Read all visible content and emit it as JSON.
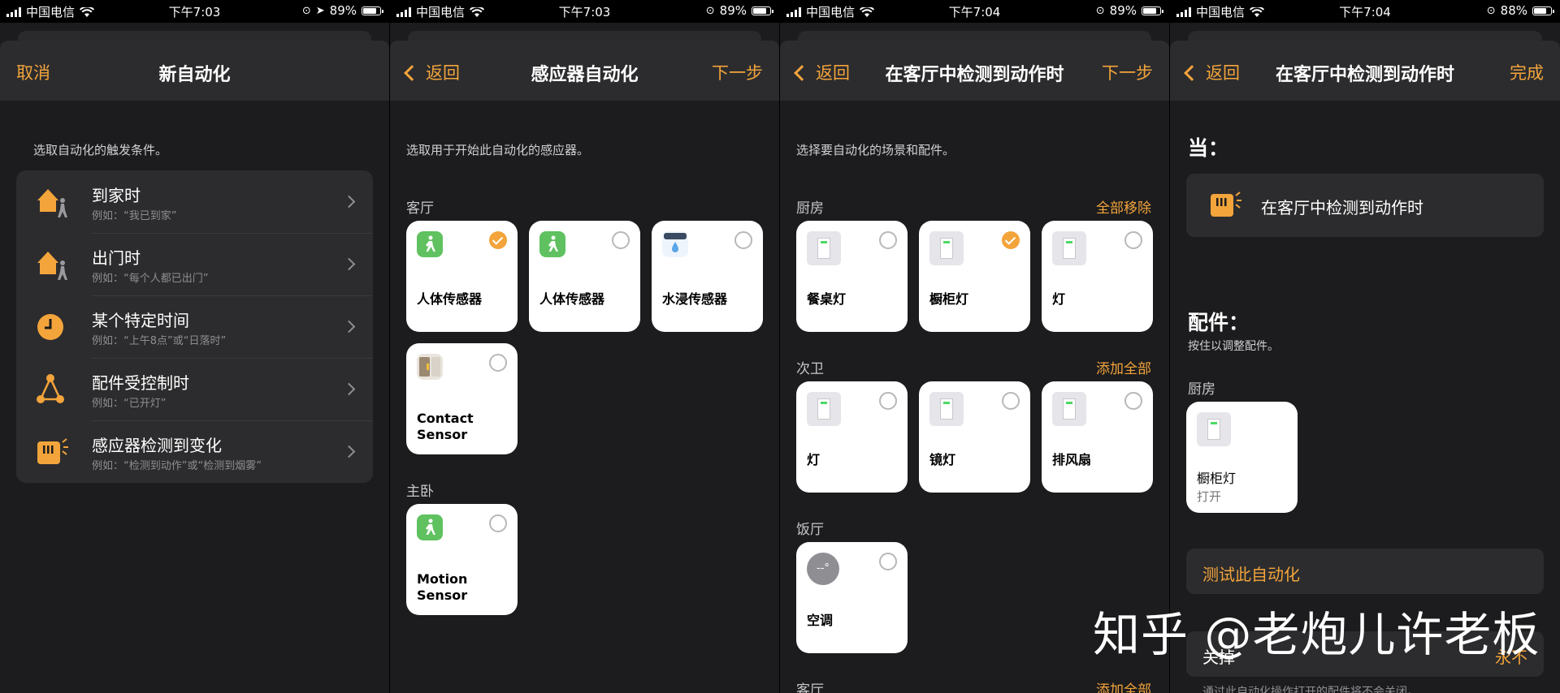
{
  "panels": [
    {
      "status": {
        "carrier": "中国电信",
        "time": "下午7:03",
        "battery": "89%"
      },
      "nav": {
        "left": "取消",
        "title": "新自动化",
        "right": ""
      },
      "instruction": "选取自动化的触发条件。",
      "items": [
        {
          "title": "到家时",
          "subtitle": "例如：“我已到家”",
          "icon": "home-person-icon"
        },
        {
          "title": "出门时",
          "subtitle": "例如：“每个人都已出门”",
          "icon": "home-person-leave-icon"
        },
        {
          "title": "某个特定时间",
          "subtitle": "例如：“上午8点”或“日落时”",
          "icon": "clock-icon"
        },
        {
          "title": "配件受控制时",
          "subtitle": "例如：“已开灯”",
          "icon": "accessory-network-icon"
        },
        {
          "title": "感应器检测到变化",
          "subtitle": "例如：“检测到动作”或“检测到烟雾”",
          "icon": "sensor-icon"
        }
      ]
    },
    {
      "status": {
        "carrier": "中国电信",
        "time": "下午7:03",
        "battery": "89%"
      },
      "nav": {
        "left": "返回",
        "title": "感应器自动化",
        "right": "下一步"
      },
      "instruction": "选取用于开始此自动化的感应器。",
      "sections": [
        {
          "label": "客厅",
          "tiles": [
            {
              "name": "人体传感器",
              "icon": "motion-sensor-icon",
              "checked": true
            },
            {
              "name": "人体传感器",
              "icon": "motion-sensor-icon",
              "checked": false
            },
            {
              "name": "水浸传感器",
              "icon": "water-sensor-icon",
              "checked": false
            },
            {
              "name": "Contact Sensor",
              "icon": "contact-sensor-icon",
              "checked": false
            }
          ]
        },
        {
          "label": "主卧",
          "tiles": [
            {
              "name": "Motion Sensor",
              "icon": "motion-sensor-icon",
              "checked": false
            }
          ]
        }
      ]
    },
    {
      "status": {
        "carrier": "中国电信",
        "time": "下午7:04",
        "battery": "89%"
      },
      "nav": {
        "left": "返回",
        "title": "在客厅中检测到动作时",
        "right": "下一步"
      },
      "instruction": "选择要自动化的场景和配件。",
      "sections": [
        {
          "label": "厨房",
          "action": "全部移除",
          "tiles": [
            {
              "name": "餐桌灯",
              "icon": "light-switch-icon",
              "checked": false
            },
            {
              "name": "橱柜灯",
              "icon": "light-switch-icon",
              "checked": true
            },
            {
              "name": "灯",
              "icon": "light-switch-icon",
              "checked": false
            }
          ]
        },
        {
          "label": "次卫",
          "action": "添加全部",
          "tiles": [
            {
              "name": "灯",
              "icon": "light-switch-icon",
              "checked": false
            },
            {
              "name": "镜灯",
              "icon": "light-switch-icon",
              "checked": false
            },
            {
              "name": "排风扇",
              "icon": "light-switch-icon",
              "checked": false
            }
          ]
        },
        {
          "label": "饭厅",
          "tiles": [
            {
              "name": "空调",
              "icon": "thermostat-icon",
              "checked": false,
              "icon_text": "--°"
            }
          ]
        },
        {
          "label": "客厅",
          "action": "添加全部",
          "tiles": []
        }
      ]
    },
    {
      "status": {
        "carrier": "中国电信",
        "time": "下午7:04",
        "battery": "88%"
      },
      "nav": {
        "left": "返回",
        "title": "在客厅中检测到动作时",
        "right": "完成"
      },
      "when_heading": "当：",
      "trigger": "在客厅中检测到动作时",
      "accessories_heading": "配件：",
      "accessories_hint": "按住以调整配件。",
      "room": "厨房",
      "tile": {
        "name": "橱柜灯",
        "state": "打开"
      },
      "test_button": "测试此自动化",
      "off_label": "关掉",
      "off_value": "永不",
      "footer_hint": "通过此自动化操作打开的配件将不会关闭。"
    }
  ],
  "watermark": "知乎 @老炮儿许老板",
  "colors": {
    "accent": "#f3a43b",
    "background": "#1c1c1e",
    "cell": "#2c2c2e"
  }
}
